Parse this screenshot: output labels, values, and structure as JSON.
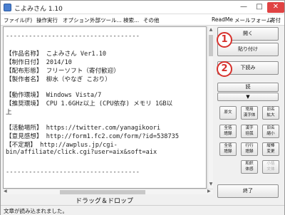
{
  "window": {
    "title": "こよみさん 1.10",
    "controls": {
      "minimize": "—",
      "maximize": "□",
      "close": "✕"
    }
  },
  "menubar": {
    "items": [
      "ファイル(F)",
      "操作実行",
      "オプション",
      "外部ツール...",
      "検索...",
      "その他",
      "ReadMe",
      "メールフォーム",
      "寄付"
    ]
  },
  "text_lines": [
    "-----------------------------------",
    "【作品名称】 こよみさん Ver1.10",
    "【制作日付】 2014/10",
    "【配布形態】 フリーソフト（寄付歓迎）",
    "【製作者名】 柳水（やなぎ こおり）",
    "【動作環境】 Windows Vista/7",
    "【推奨環境】 CPU 1.6GHz以上 (CPU依存)  メモリ 1GB以",
    "上",
    "【活動場所】 https://twitter.com/yanagikoori",
    "【意見感想】 http://form1.fc2.com/form/?id=538735",
    "【不定期】 http://awplus.jp/cgi-",
    "bin/affiliate/click.cgi?user=aix&soft=aix",
    "-----------------------------------"
  ],
  "side_panel": {
    "open_button": "開く",
    "paste_button": "貼り付け",
    "read_button": "下読み",
    "read_speed": "読",
    "down_arrow": "▼",
    "small_buttons": [
      [
        "原文",
        "常用\n漢字体",
        "旧名\n拡大"
      ],
      [
        "全括\n語録",
        "漢字\n括弧",
        "旧名\n縮小"
      ],
      [
        "全括\n語録",
        "行行\n語録",
        "縦棒\n変更"
      ],
      [
        "和訳\n体感",
        "小括\n文体"
      ]
    ],
    "exit_button": "終了"
  },
  "annotations": {
    "circle1": "1",
    "circle2": "2"
  },
  "drag_drop_label": "ドラッグ＆ドロップ",
  "status_text": "文章が読み込まれました。"
}
